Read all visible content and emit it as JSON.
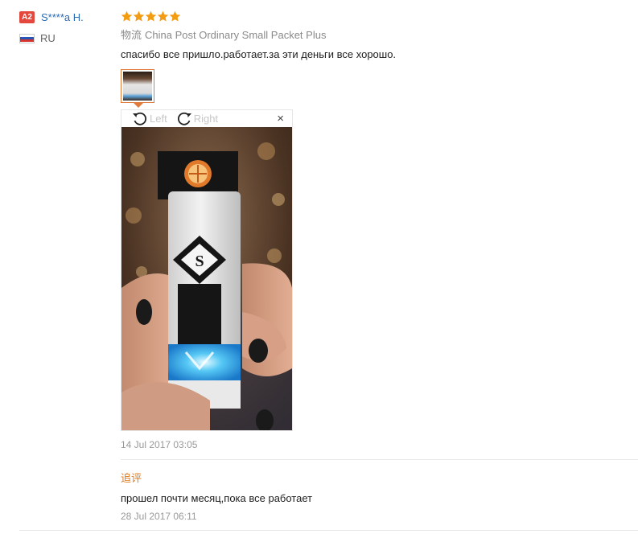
{
  "user": {
    "level_badge": "A2",
    "name": "S****a H.",
    "country": "RU"
  },
  "review": {
    "stars": 5,
    "shipping_prefix": "物流",
    "shipping_method": "China Post Ordinary Small Packet Plus",
    "text": "спасибо все пришло.работает.за эти деньги все хорошо.",
    "date": "14 Jul 2017 03:05"
  },
  "viewer": {
    "rotate_left_label": "Left",
    "rotate_right_label": "Right",
    "close_symbol": "×"
  },
  "additional": {
    "label": "追评",
    "text": "прошел почти месяц,пока все работает",
    "date": "28 Jul 2017 06:11"
  },
  "colors": {
    "star": "#f39c12",
    "badge": "#e4473b",
    "username": "#2a6bb5",
    "accent": "#e07b20"
  }
}
